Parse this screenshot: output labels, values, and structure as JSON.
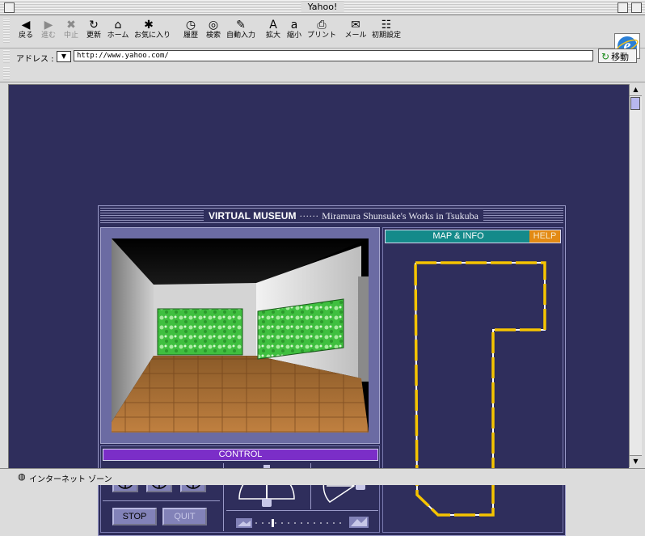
{
  "window": {
    "title": "Yahoo!"
  },
  "toolbar": {
    "buttons": [
      {
        "label": "戻る",
        "icon": "back-arrow-icon",
        "glyph": "◀",
        "enabled": true
      },
      {
        "label": "進む",
        "icon": "forward-arrow-icon",
        "glyph": "▶",
        "enabled": false
      },
      {
        "label": "中止",
        "icon": "stop-icon",
        "glyph": "✖",
        "enabled": false
      },
      {
        "label": "更新",
        "icon": "refresh-icon",
        "glyph": "↻",
        "enabled": true
      },
      {
        "label": "ホーム",
        "icon": "home-icon",
        "glyph": "⌂",
        "enabled": true
      },
      {
        "label": "お気に入り",
        "icon": "favorites-icon",
        "glyph": "✱",
        "enabled": true
      },
      {
        "label": "履歴",
        "icon": "history-icon",
        "glyph": "◷",
        "enabled": true
      },
      {
        "label": "検索",
        "icon": "search-icon",
        "glyph": "◎",
        "enabled": true
      },
      {
        "label": "自動入力",
        "icon": "autofill-icon",
        "glyph": "✎",
        "enabled": true
      },
      {
        "label": "拡大",
        "icon": "text-larger-icon",
        "glyph": "A",
        "enabled": true
      },
      {
        "label": "縮小",
        "icon": "text-smaller-icon",
        "glyph": "a",
        "enabled": true
      },
      {
        "label": "プリント",
        "icon": "printer-icon",
        "glyph": "⎙",
        "enabled": true
      },
      {
        "label": "メール",
        "icon": "mail-icon",
        "glyph": "✉",
        "enabled": true
      },
      {
        "label": "初期設定",
        "icon": "preferences-icon",
        "glyph": "☷",
        "enabled": true
      }
    ]
  },
  "address": {
    "label": "アドレス :",
    "url": "http://www.yahoo.com/",
    "go_label": "移動"
  },
  "status": {
    "text": "インターネット ゾーン"
  },
  "museum": {
    "title": "VIRTUAL MUSEUM",
    "separator": "······",
    "subtitle": "Miramura Shunsuke's Works in Tsukuba",
    "map_label": "MAP & INFO",
    "help_label": "HELP",
    "control_label": "CONTROL",
    "stop_label": "STOP",
    "quit_label": "QUIT"
  },
  "colors": {
    "page_bg": "#2f2e5c",
    "map_header": "#148a8a",
    "help": "#e38a14",
    "control_header": "#7b2ec8",
    "map_path": "#f5c400",
    "painting": "#3fbf3f"
  }
}
